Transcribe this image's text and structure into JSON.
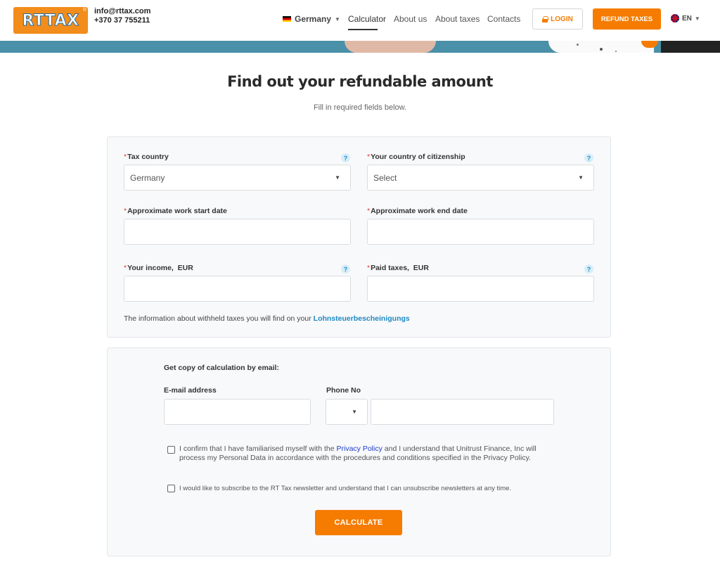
{
  "header": {
    "logo_text": "RTTAX",
    "logo_mark": "®",
    "email": "info@rttax.com",
    "phone": "+370 37 755211",
    "country_selector": "Germany",
    "nav": {
      "calculator": "Calculator",
      "about_us": "About us",
      "about_taxes": "About taxes",
      "contacts": "Contacts"
    },
    "login_label": "LOGIN",
    "refund_label": "REFUND TAXES",
    "language": "EN"
  },
  "main": {
    "title": "Find out your refundable amount",
    "subtitle": "Fill in required fields below."
  },
  "calculator_form": {
    "required_mark": "*",
    "help_glyph": "?",
    "tax_country_label": "Tax country",
    "tax_country_value": "Germany",
    "citizenship_label": "Your country of citizenship",
    "citizenship_value": "Select",
    "start_date_label": "Approximate work start date",
    "end_date_label": "Approximate work end date",
    "income_label": "Your income,  EUR",
    "paid_taxes_label": "Paid taxes,  EUR",
    "info_text": "The information about withheld taxes you will find on your ",
    "info_link": "Lohnsteuerbescheinigungs"
  },
  "email_form": {
    "heading": "Get copy of calculation by email:",
    "email_label": "E-mail address",
    "phone_label": "Phone No",
    "consent_privacy_part1": "I confirm that I have familiarised myself with the ",
    "consent_privacy_link": "Privacy Policy",
    "consent_privacy_part2": " and I understand that Unitrust Finance, Inc will",
    "consent_privacy_line2": "process my Personal Data in accordance with the procedures and conditions specified in the Privacy Policy.",
    "consent_newsletter": "I would like to subscribe to the RT Tax newsletter and understand that I can unsubscribe newsletters at any time.",
    "calculate_label": "CALCULATE"
  },
  "colors": {
    "accent": "#f57c00",
    "link": "#1e88c7",
    "hero": "#4a90a8"
  }
}
